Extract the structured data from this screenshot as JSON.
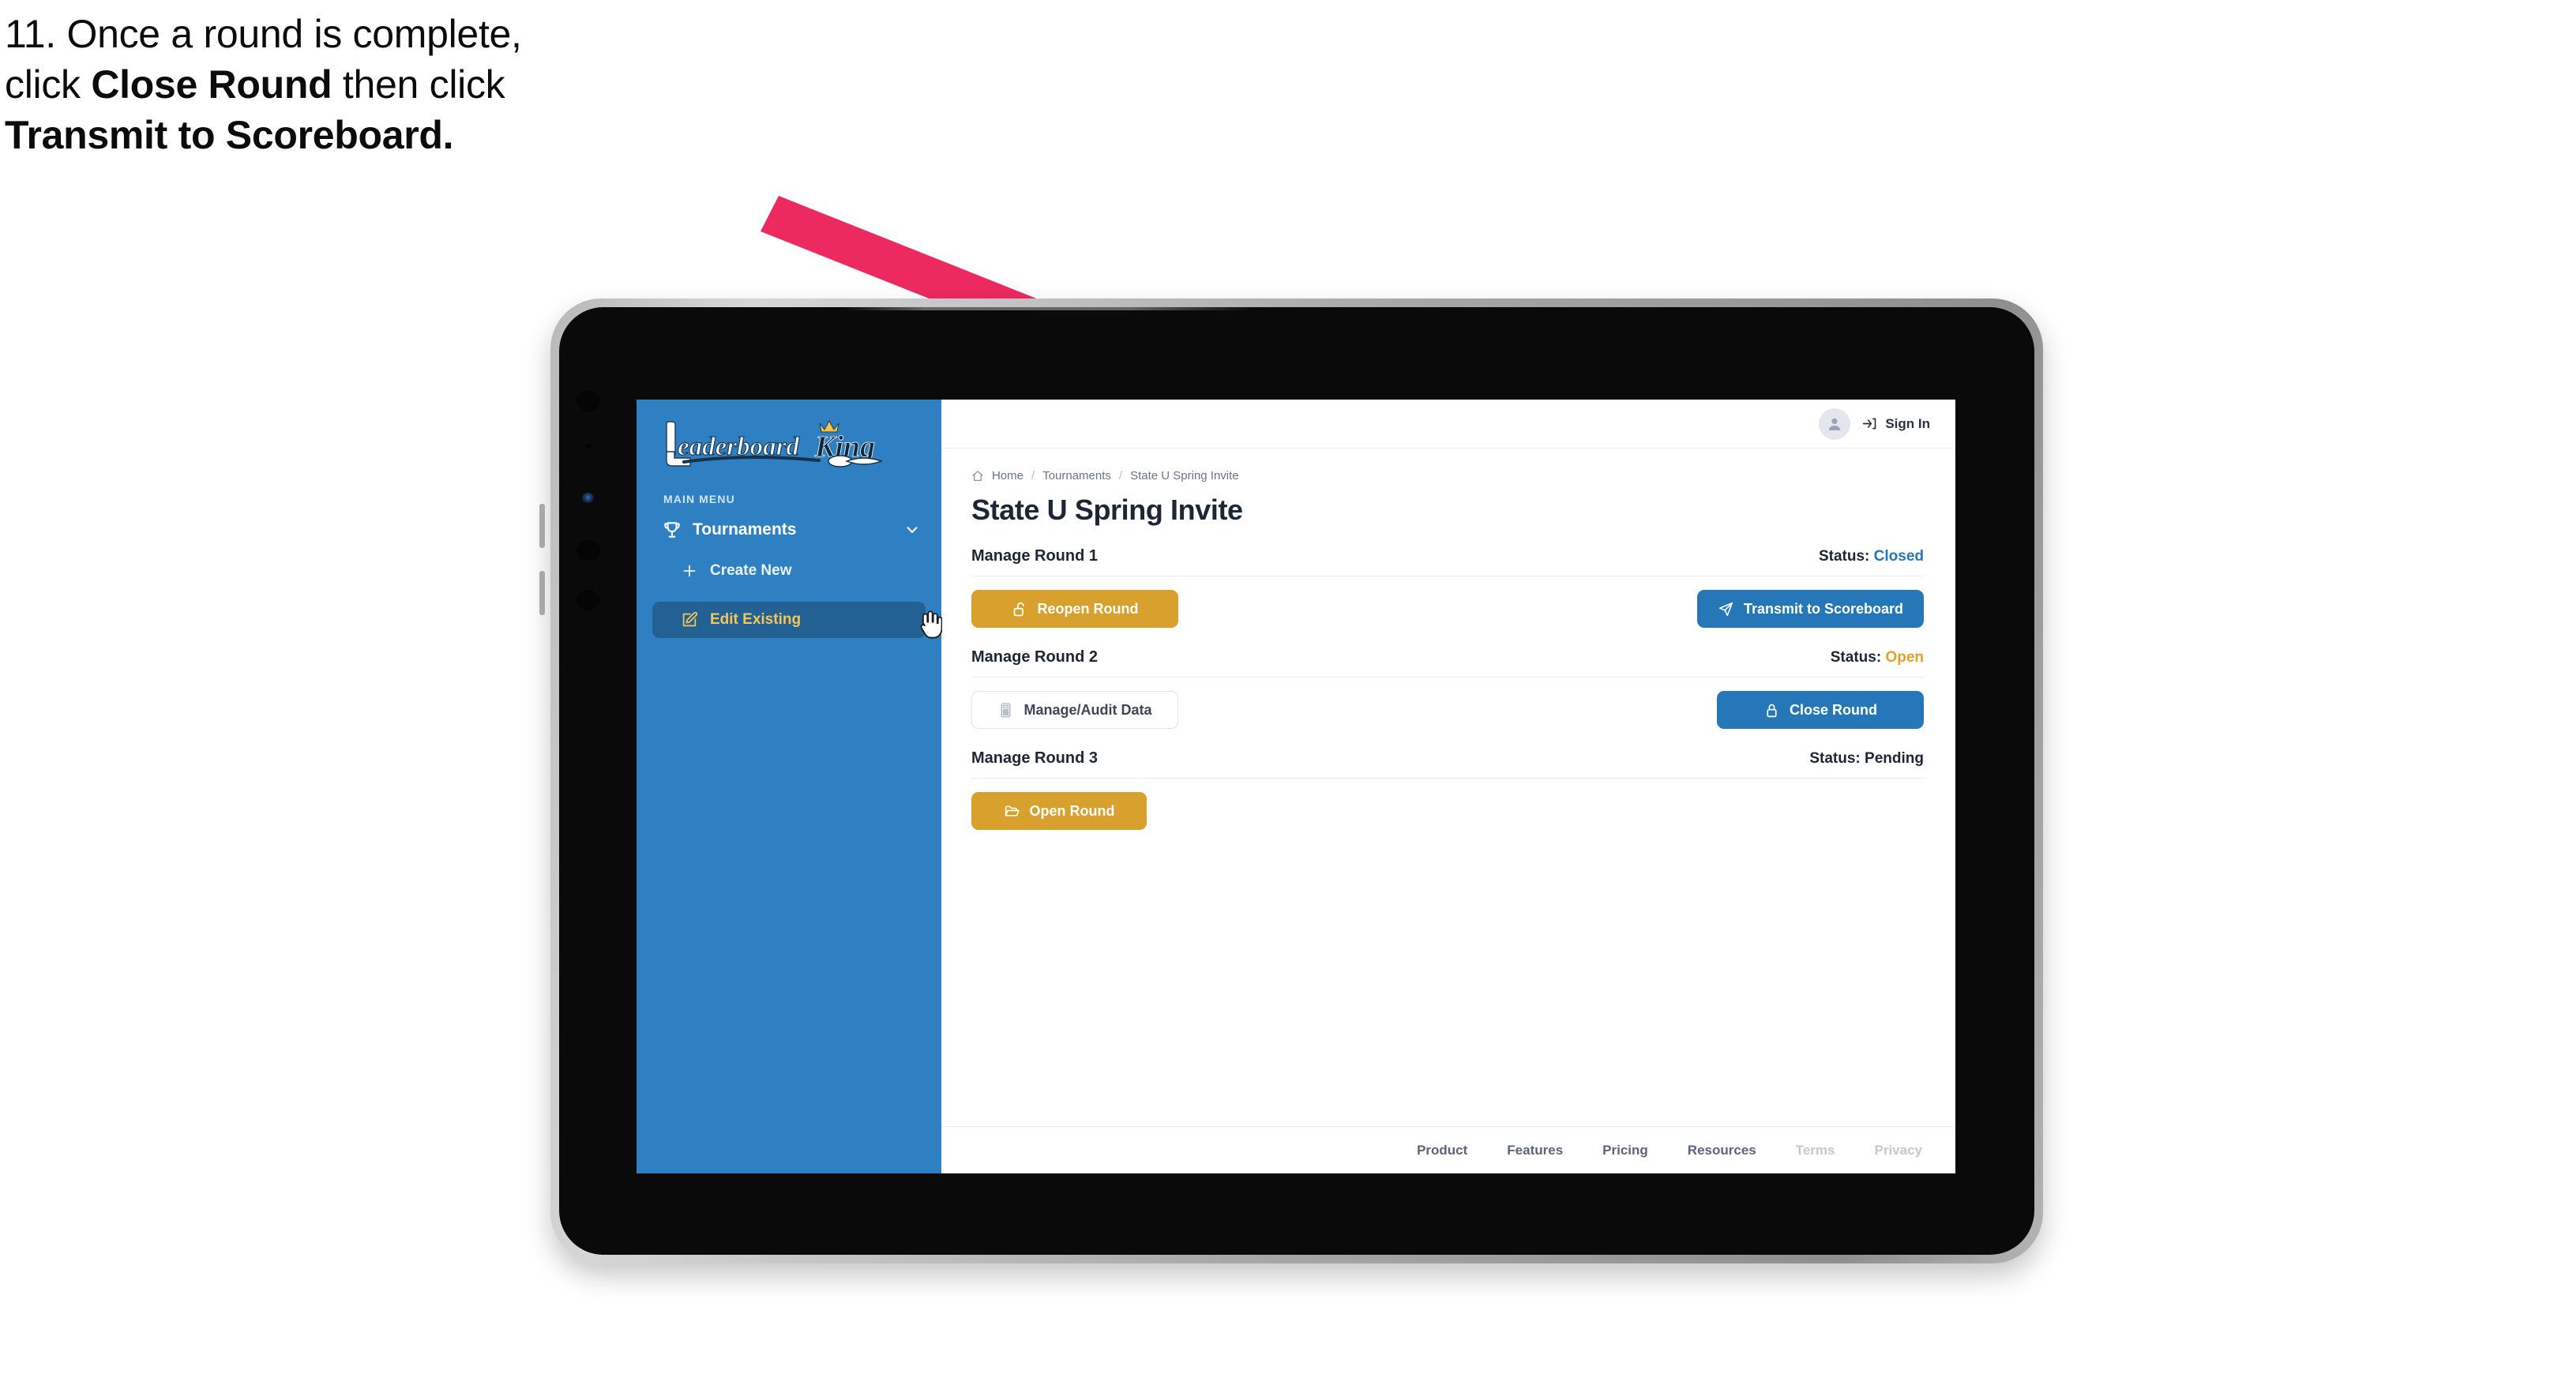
{
  "caption": {
    "line1": "11. Once a round is complete,",
    "line2_pre": "click ",
    "line2_bold": "Close Round",
    "line2_post": " then click",
    "line3_bold": "Transmit to Scoreboard."
  },
  "annotation": {
    "arrow_color": "#ec2a60",
    "name": "pointer-arrow-to-transmit-button"
  },
  "app": {
    "sidebar": {
      "logo_text": "LeaderboardKing",
      "menu_label": "MAIN MENU",
      "nav": {
        "label": "Tournaments",
        "icon": "trophy-icon",
        "chevron": "chevron-down-icon"
      },
      "items": [
        {
          "label": "Create New",
          "icon": "plus-icon",
          "active": false
        },
        {
          "label": "Edit Existing",
          "icon": "edit-square-icon",
          "active": true
        }
      ],
      "accent_bg": "#2f80c2",
      "active_bg": "#236094",
      "active_text": "#f4c75a"
    },
    "topbar": {
      "avatar": "user-avatar-icon",
      "signin_label": "Sign In",
      "signin_icon": "sign-in-arrow-icon"
    },
    "breadcrumb": {
      "home_icon": "home-icon",
      "items": [
        "Home",
        "Tournaments",
        "State U Spring Invite"
      ],
      "separator": "/"
    },
    "page_title": "State U Spring Invite",
    "rounds": [
      {
        "title": "Manage Round 1",
        "status_label": "Status:",
        "status_value": "Closed",
        "status_color": "#2577b8",
        "left_button": {
          "label": "Reopen Round",
          "icon": "unlock-icon",
          "style": "amber"
        },
        "right_button": {
          "label": "Transmit to Scoreboard",
          "icon": "paper-plane-icon",
          "style": "blue"
        }
      },
      {
        "title": "Manage Round 2",
        "status_label": "Status:",
        "status_value": "Open",
        "status_color": "#e0a22b",
        "left_button": {
          "label": "Manage/Audit Data",
          "icon": "calculator-icon",
          "style": "ghost"
        },
        "right_button": {
          "label": "Close Round",
          "icon": "lock-icon",
          "style": "blue"
        }
      },
      {
        "title": "Manage Round 3",
        "status_label": "Status:",
        "status_value": "Pending",
        "status_color": "#1d2635",
        "left_button": {
          "label": "Open Round",
          "icon": "folder-open-icon",
          "style": "amber"
        },
        "right_button": null
      }
    ],
    "footer": {
      "links": [
        {
          "label": "Product",
          "muted": false
        },
        {
          "label": "Features",
          "muted": false
        },
        {
          "label": "Pricing",
          "muted": false
        },
        {
          "label": "Resources",
          "muted": false
        },
        {
          "label": "Terms",
          "muted": true
        },
        {
          "label": "Privacy",
          "muted": true
        }
      ]
    },
    "cursor": "hand-pointer-cursor"
  }
}
